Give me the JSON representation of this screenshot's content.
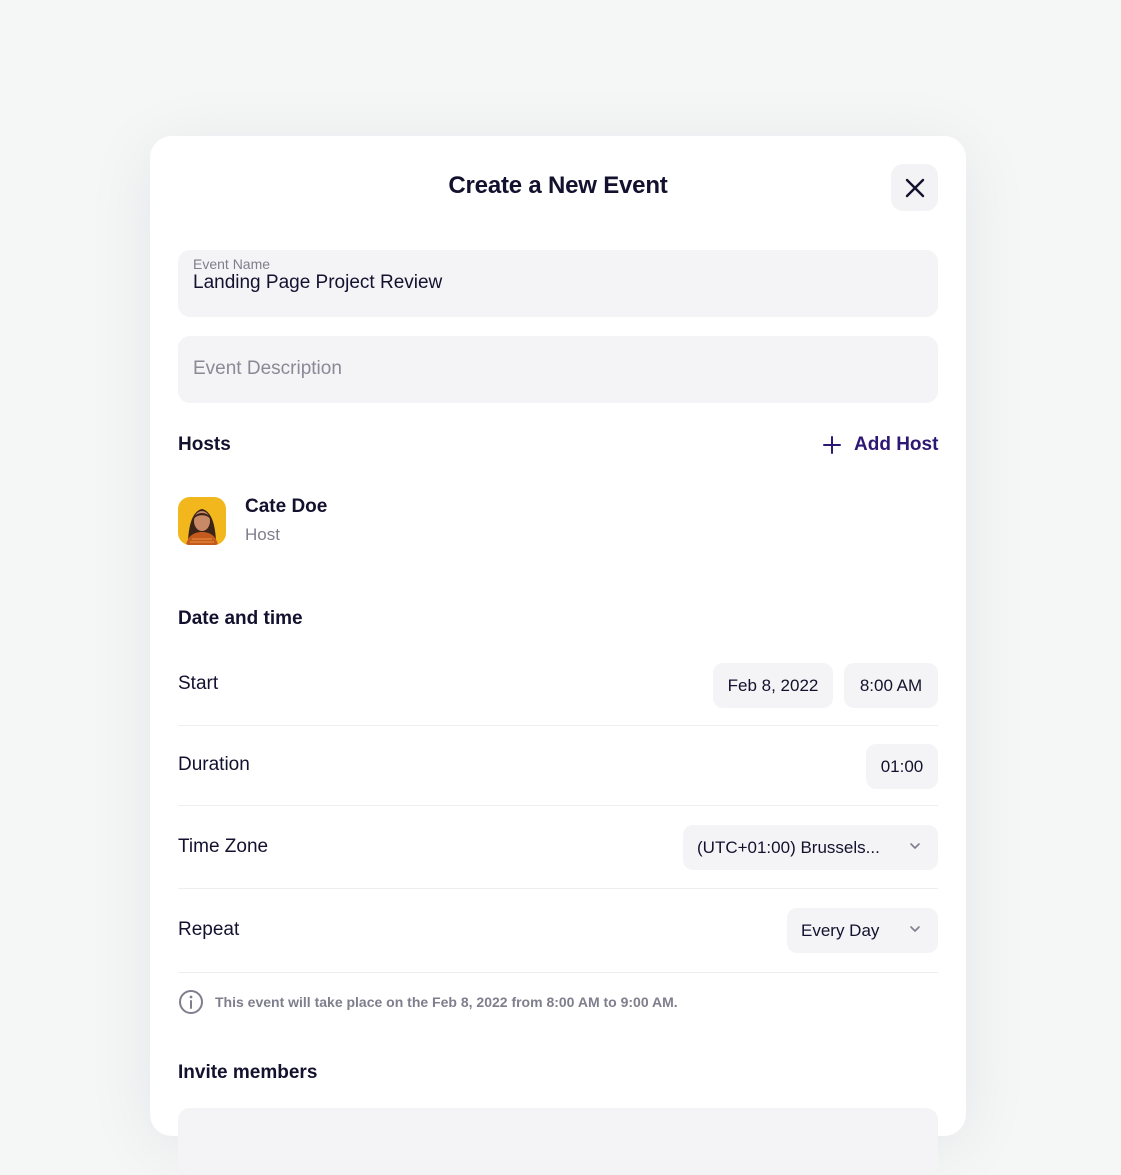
{
  "modal": {
    "title": "Create a New Event",
    "close_icon": "close-icon"
  },
  "event_name": {
    "label": "Event Name",
    "value": "Landing Page Project Review"
  },
  "event_description": {
    "placeholder": "Event Description"
  },
  "hosts": {
    "title": "Hosts",
    "add_label": "Add Host",
    "add_icon": "plus-icon",
    "items": [
      {
        "name": "Cate Doe",
        "role": "Host",
        "avatar": "avatar-photo"
      }
    ]
  },
  "date_time": {
    "title": "Date and time",
    "start": {
      "label": "Start",
      "date": "Feb 8, 2022",
      "time": "8:00 AM"
    },
    "duration": {
      "label": "Duration",
      "value": "01:00"
    },
    "time_zone": {
      "label": "Time Zone",
      "value": "(UTC+01:00) Brussels..."
    },
    "repeat": {
      "label": "Repeat",
      "value": "Every Day"
    },
    "info": "This event will take place on the Feb 8, 2022 from 8:00 AM to 9:00 AM.",
    "info_icon": "info-icon"
  },
  "invite": {
    "title": "Invite members"
  },
  "colors": {
    "background": "#f5f6f6",
    "card": "#ffffff",
    "field": "#f4f4f6",
    "text": "#13112e",
    "muted": "#7f7e8c",
    "accent": "#2e1873",
    "avatar_bg": "#f2b71c"
  }
}
